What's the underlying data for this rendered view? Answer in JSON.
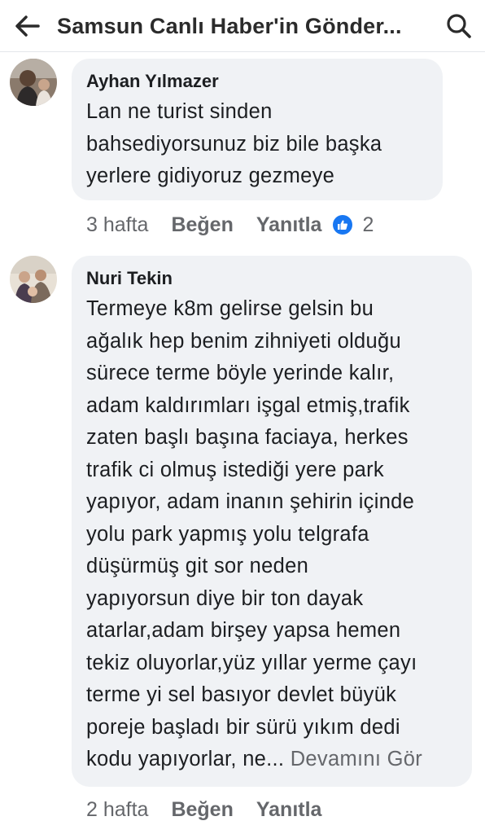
{
  "header": {
    "title": "Samsun Canlı Haber'in Gönder...",
    "back_icon": "arrow-left-icon",
    "search_icon": "search-icon"
  },
  "comments": [
    {
      "author": "Ayhan Yılmazer",
      "avatar_icon": "avatar-photo",
      "lines": [
        "Lan ne turist sinden",
        "bahsediyorsunuz  biz bile başka",
        "yerlere gidiyoruz  gezmeye"
      ],
      "time": "3 hafta",
      "like_label": "Beğen",
      "reply_label": "Yanıtla",
      "reaction_count": "2"
    },
    {
      "author": "Nuri Tekin",
      "avatar_icon": "avatar-photo",
      "lines": [
        "Termeye k8m gelirse gelsin bu",
        "ağalık hep benim zihniyeti olduğu",
        "sürece terme böyle yerinde kalır,",
        "adam kaldırımları işgal etmiş,trafik",
        "zaten başlı başına faciaya, herkes",
        "trafik ci olmuş istediği yere park",
        "yapıyor, adam inanın şehirin içinde",
        "yolu park yapmış yolu telgrafa",
        "düşürmüş git sor neden",
        "yapıyorsun diye bir ton dayak",
        "atarlar,adam birşey yapsa hemen",
        "tekiz oluyorlar,yüz yıllar yerme çayı",
        "terme yi sel basıyor devlet büyük",
        "poreje başladı bir sürü yıkım dedi",
        "kodu yapıyorlar, ne..."
      ],
      "see_more": "Devamını Gör",
      "time": "2 hafta",
      "like_label": "Beğen",
      "reply_label": "Yanıtla"
    }
  ],
  "colors": {
    "bubble": "#f0f2f5",
    "meta_text": "#65676b",
    "like_blue": "#1877f2"
  }
}
